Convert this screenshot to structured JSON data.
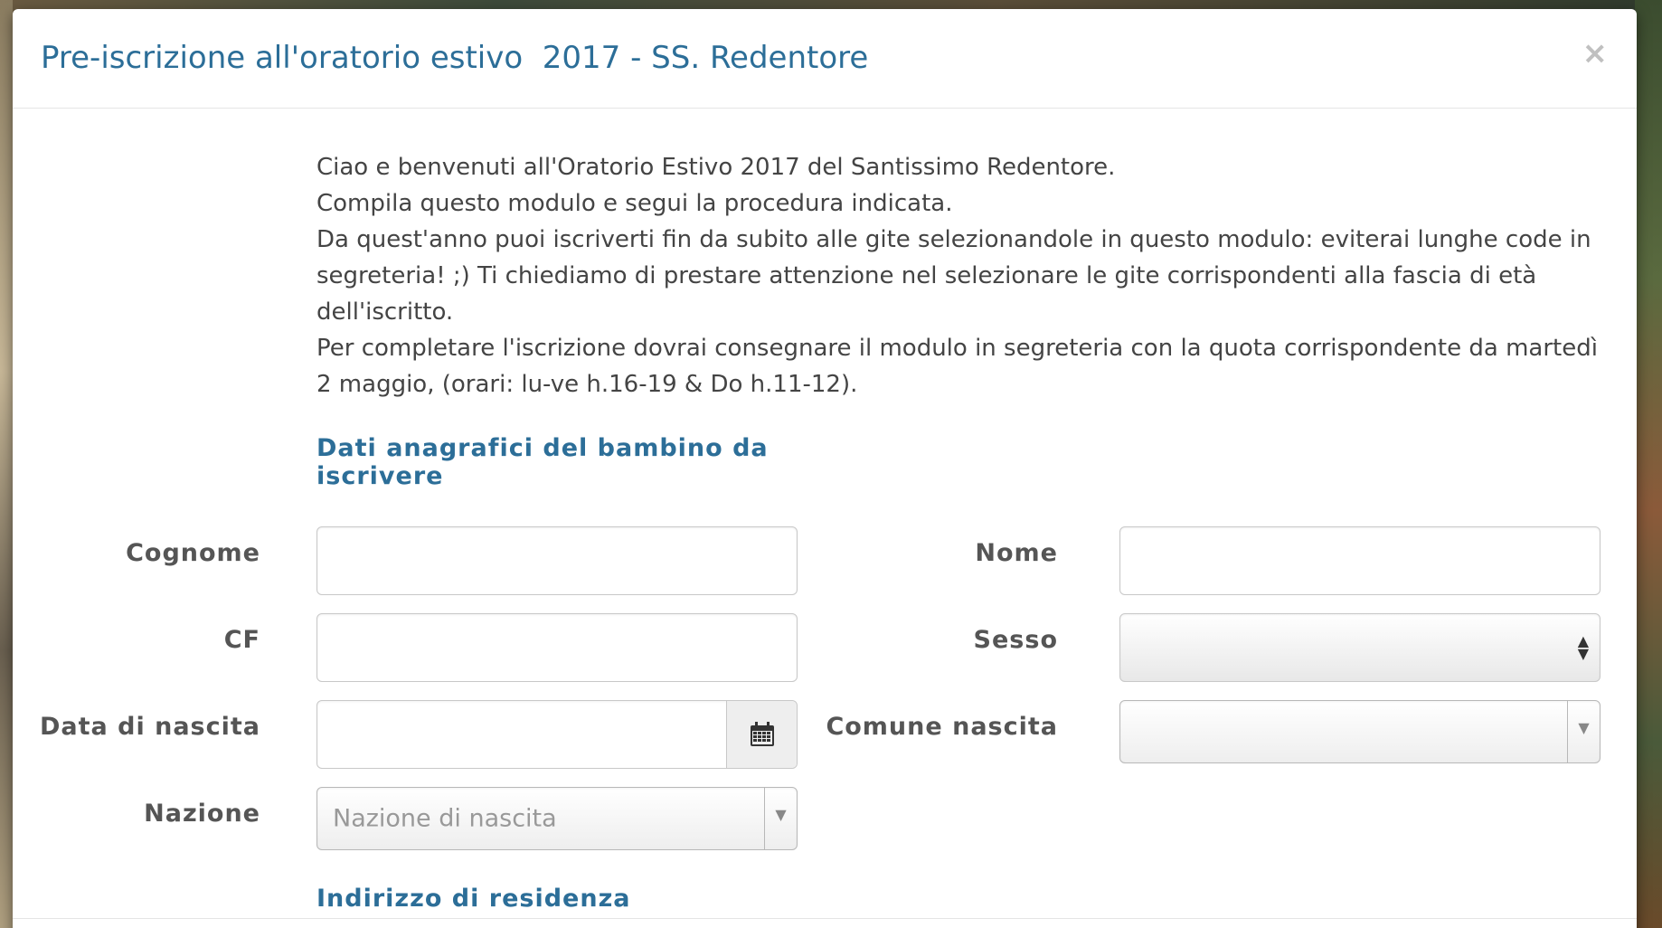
{
  "modal": {
    "title": "Pre-iscrizione all'oratorio estivo  2017 - SS. Redentore",
    "close_label": "×"
  },
  "intro": {
    "lines": [
      "Ciao e benvenuti all'Oratorio Estivo 2017 del Santissimo Redentore.",
      "Compila questo modulo e segui la procedura indicata.",
      "Da quest'anno puoi iscriverti fin da subito alle gite selezionandole in questo modulo: eviterai lunghe code in segreteria! ;) Ti chiediamo di prestare attenzione nel selezionare le gite corrispondenti alla fascia di età dell'iscritto.",
      "Per completare l'iscrizione dovrai consegnare il modulo in segreteria con la quota corrispondente da martedì 2 maggio, (orari: lu-ve h.16-19 & Do h.11-12)."
    ]
  },
  "sections": {
    "child_data": "Dati anagrafici del bambino da iscrivere",
    "residence": "Indirizzo di residenza"
  },
  "form": {
    "cognome_label": "Cognome",
    "cognome_value": "",
    "nome_label": "Nome",
    "nome_value": "",
    "cf_label": "CF",
    "cf_value": "",
    "sesso_label": "Sesso",
    "data_nascita_label": "Data di nascita",
    "data_nascita_value": "",
    "comune_nascita_label": "Comune nascita",
    "comune_nascita_value": "",
    "nazione_label": "Nazione",
    "nazione_placeholder": "Nazione di nascita"
  },
  "icons": {
    "close": "close-icon",
    "calendar": "calendar-icon",
    "select_arrows": "updown-arrows-icon",
    "dropdown": "chevron-down-icon"
  },
  "colors": {
    "accent": "#2c6e98",
    "label": "#555555",
    "text": "#444444"
  }
}
